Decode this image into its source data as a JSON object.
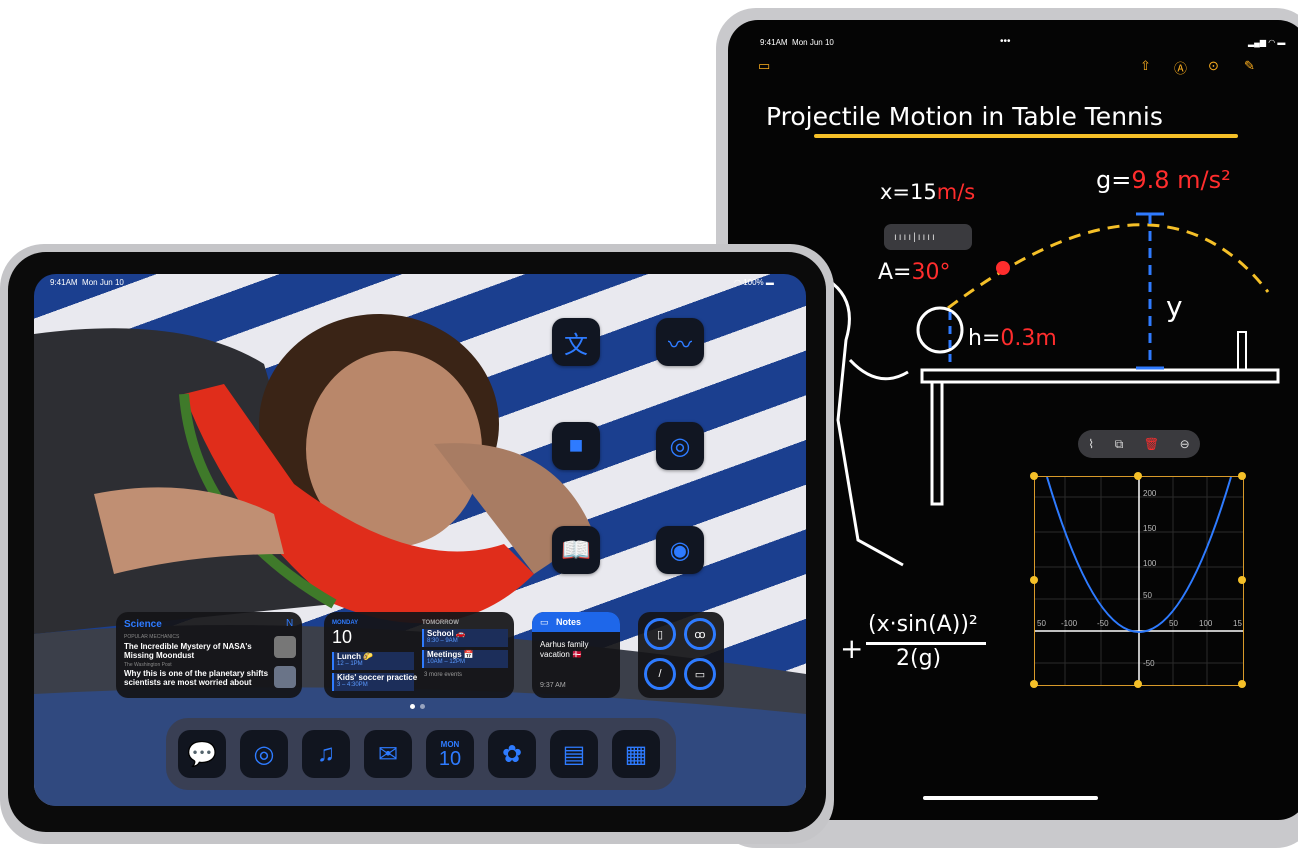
{
  "back_ipad": {
    "status": {
      "time": "9:41AM",
      "date": "Mon Jun 10",
      "dots": "•••"
    },
    "toolbar_icons": [
      "sidebar-icon",
      "share-icon",
      "markup-icon",
      "more-icon",
      "compose-icon"
    ],
    "note": {
      "title": "Projectile Motion in Table Tennis",
      "x_label": "x=",
      "x_value": "15",
      "x_unit": "m/s",
      "g_label": "g=",
      "g_value": "9.8 m/s²",
      "a_label": "A=",
      "a_value": "30°",
      "h_label": "h=",
      "h_value": "0.3m",
      "y_label": "y",
      "formula_plus": "+",
      "formula_numerator": "(x·sin(A))²",
      "formula_denominator": "2(g)"
    },
    "graph_toolbar": [
      "graph-icon",
      "duplicate-icon",
      "trash-icon",
      "minus-circle-icon"
    ],
    "graph": {
      "y_ticks": [
        "200",
        "150",
        "100",
        "50",
        "-50"
      ],
      "x_ticks": [
        "50",
        "-100",
        "-50",
        "50",
        "100",
        "15"
      ]
    }
  },
  "front_ipad": {
    "status": {
      "time": "9:41AM",
      "date": "Mon Jun 10",
      "battery": "100%"
    },
    "apps_right": [
      {
        "name": "translate-icon",
        "glyph": "文"
      },
      {
        "name": "freeform-icon",
        "glyph": "〰"
      },
      {
        "name": "facetime-icon",
        "glyph": "■"
      },
      {
        "name": "find-my-icon",
        "glyph": "◎"
      },
      {
        "name": "books-icon",
        "glyph": "📖"
      },
      {
        "name": "podcasts-icon",
        "glyph": "◉"
      }
    ],
    "news_widget": {
      "category": "Science",
      "source1": "POPULAR MECHANICS",
      "headline1": "The Incredible Mystery of NASA's Missing Moondust",
      "source2": "The Washington Post",
      "headline2": "Why this is one of the planetary shifts scientists are most worried about"
    },
    "calendar_widget": {
      "today_label": "MONDAY",
      "today_num": "10",
      "tomorrow_label": "TOMORROW",
      "event1": "Lunch 🌮",
      "event1_time": "12 – 1PM",
      "event2": "Kids' soccer practice",
      "event2_time": "3 – 4:30PM",
      "event3": "School 🚗",
      "event3_time": "8:30 – 9AM",
      "event4": "Meetings 📅",
      "event4_time": "10AM – 12PM",
      "more": "3 more events"
    },
    "notes_widget": {
      "header": "Notes",
      "title": "Aarhus family vacation 🇩🇰",
      "time": "9:37 AM"
    },
    "batteries_widget": [
      "ipad-battery-icon",
      "airpods-battery-icon",
      "pencil-battery-icon",
      "case-battery-icon"
    ],
    "dock": [
      {
        "name": "messages-icon",
        "glyph": "💬"
      },
      {
        "name": "safari-icon",
        "glyph": "◎"
      },
      {
        "name": "music-icon",
        "glyph": "♫"
      },
      {
        "name": "mail-icon",
        "glyph": "✉"
      },
      {
        "name": "calendar-icon",
        "month": "MON",
        "day": "10"
      },
      {
        "name": "photos-icon",
        "glyph": "✿"
      },
      {
        "name": "wallet-icon",
        "glyph": "▤"
      },
      {
        "name": "app-library-icon",
        "glyph": "▦"
      }
    ]
  },
  "colors": {
    "accent_blue": "#2e7bff",
    "note_red": "#ff2d2d",
    "note_yellow": "#f5c028",
    "pencil_orange": "#ffb01f"
  }
}
